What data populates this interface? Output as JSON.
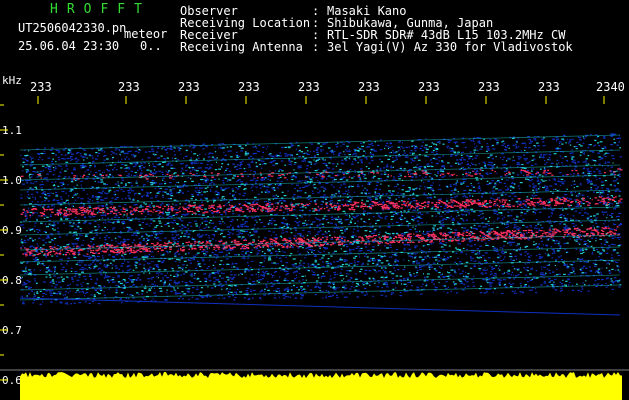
{
  "header": {
    "title": "HROFFT",
    "file": "UT2506042330.pn",
    "meteor": "meteor",
    "timestamp": "25.06.04 23:30",
    "extra": "0..",
    "info": [
      {
        "label": "Observer",
        "value": "Masaki Kano"
      },
      {
        "label": "Receiving Location",
        "value": "Shibukawa, Gunma, Japan"
      },
      {
        "label": "Receiver",
        "value": "RTL-SDR SDR# 43dB L15 103.2MHz CW"
      },
      {
        "label": "Receiving Antenna",
        "value": "3el Yagi(V) Az 330 for Vladivostok"
      }
    ]
  },
  "axis": {
    "unit": "kHz",
    "time_ticks": [
      "233",
      "233",
      "233",
      "233",
      "233",
      "233",
      "233",
      "233",
      "233",
      "2340"
    ],
    "freq_ticks": [
      "1.1",
      "1.0",
      "0.9",
      "0.8",
      "0.7",
      "0.6"
    ]
  },
  "colors": {
    "background": "#000000",
    "text": "#ffffff",
    "title": "#33dd33",
    "tick": "#ffff00",
    "signal_low": "#1030c0",
    "signal_mid": "#20d0d0",
    "signal_high": "#ff3060",
    "power": "#ffff00"
  }
}
